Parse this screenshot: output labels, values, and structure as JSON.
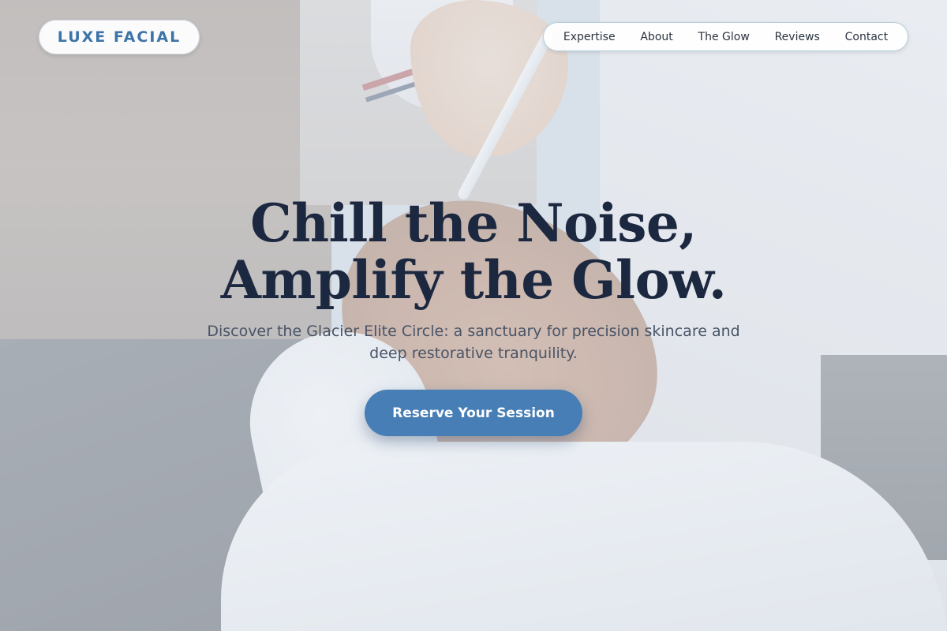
{
  "brand": {
    "logo_text": "LUXE FACIAL",
    "accent_color": "#477eb5",
    "logo_color": "#3d74a8",
    "heading_color": "#1c2840"
  },
  "nav": {
    "items": [
      {
        "label": "Expertise"
      },
      {
        "label": "About"
      },
      {
        "label": "The Glow"
      },
      {
        "label": "Reviews"
      },
      {
        "label": "Contact"
      }
    ]
  },
  "hero": {
    "headline_line1": "Chill the Noise,",
    "headline_line2": "Amplify the Glow.",
    "subtitle": "Discover the Glacier Elite Circle: a sanctuary for precision skincare and deep restorative tranquility.",
    "cta_label": "Reserve Your Session",
    "background_image": "facial-treatment-photo"
  }
}
